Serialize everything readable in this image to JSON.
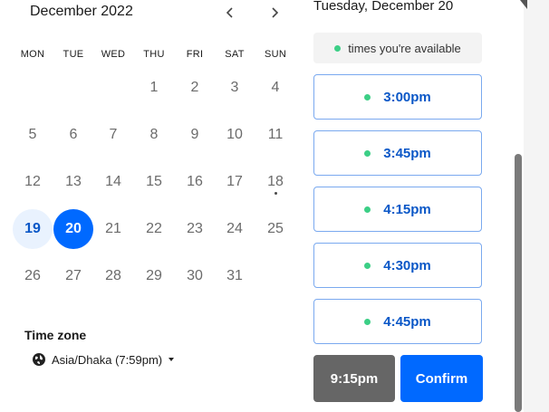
{
  "calendar": {
    "month_label": "December 2022",
    "prev_icon": "chevron-left-icon",
    "next_icon": "chevron-right-icon",
    "weekdays": [
      "MON",
      "TUE",
      "WED",
      "THU",
      "FRI",
      "SAT",
      "SUN"
    ],
    "weeks": [
      [
        "",
        "",
        "",
        "1",
        "2",
        "3",
        "4"
      ],
      [
        "5",
        "6",
        "7",
        "8",
        "9",
        "10",
        "11"
      ],
      [
        "12",
        "13",
        "14",
        "15",
        "16",
        "17",
        "18"
      ],
      [
        "19",
        "20",
        "21",
        "22",
        "23",
        "24",
        "25"
      ],
      [
        "26",
        "27",
        "28",
        "29",
        "30",
        "31",
        ""
      ]
    ],
    "available_day": "19",
    "selected_day": "20",
    "today_marker_day": "18"
  },
  "timezone": {
    "label": "Time zone",
    "value": "Asia/Dhaka (7:59pm)",
    "icon": "globe-icon"
  },
  "schedule": {
    "date_heading": "Tuesday, December 20",
    "legend_text": "times you're available",
    "slots": [
      "3:00pm",
      "3:45pm",
      "4:15pm",
      "4:30pm",
      "4:45pm"
    ],
    "selected_time": "9:15pm",
    "confirm_label": "Confirm"
  },
  "colors": {
    "accent": "#0069ff",
    "available_green": "#3ccf86",
    "selected_time_bg": "#666666"
  }
}
